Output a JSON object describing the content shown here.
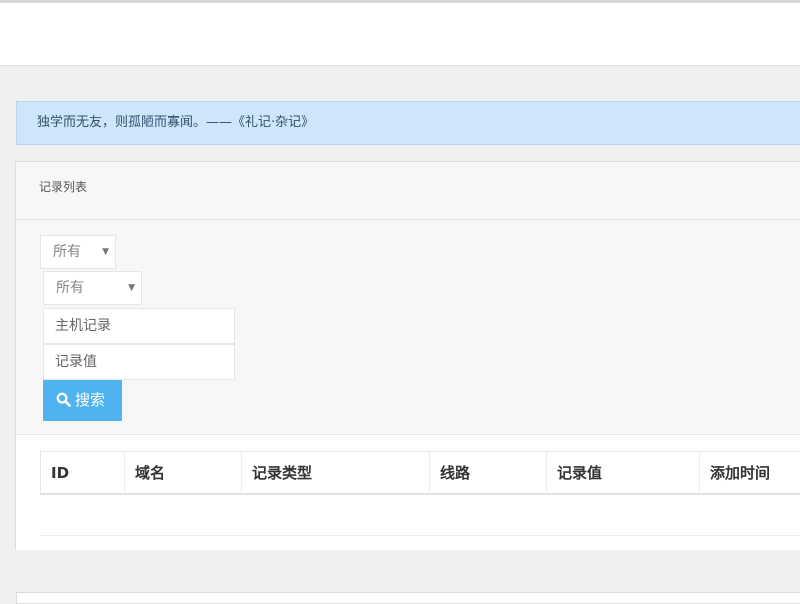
{
  "notice": {
    "text": "独学而无友，则孤陋而寡闻。——《礼记·杂记》"
  },
  "panel": {
    "title": "记录列表"
  },
  "filters": {
    "type_select": "所有",
    "line_select": "所有",
    "host_placeholder": "主机记录",
    "value_placeholder": "记录值",
    "search_label": "搜索"
  },
  "table": {
    "columns": [
      "ID",
      "域名",
      "记录类型",
      "线路",
      "记录值",
      "添加时间"
    ]
  },
  "icons": {
    "search": "search-icon",
    "caret": "caret-down-icon"
  },
  "colors": {
    "accent": "#4fb3f0",
    "notice_bg": "#cfe6fa"
  }
}
